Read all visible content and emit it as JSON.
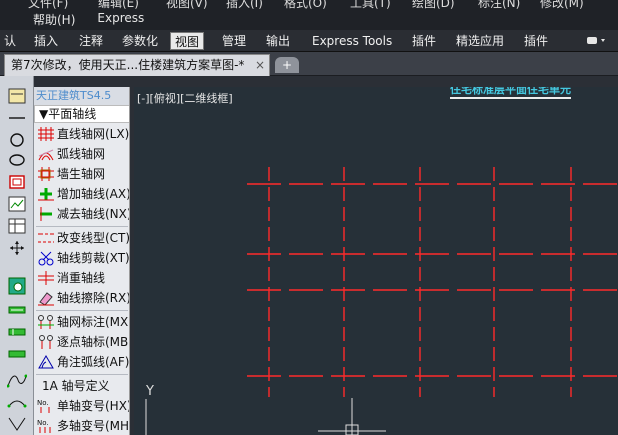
{
  "menu_cut": [
    "文件(F)",
    "编辑(E)",
    "视图(V)",
    "插入(I)",
    "格式(O)",
    "工具(T)",
    "绘图(D)",
    "标注(N)",
    "修改(M)"
  ],
  "menu": {
    "help": "帮助(H)",
    "express": "Express"
  },
  "ribbon_tabs": [
    "认",
    "插入",
    "注释",
    "参数化",
    "视图",
    "管理",
    "输出",
    "Express Tools",
    "插件",
    "精选应用",
    "插件"
  ],
  "ribbon_active": "视图",
  "ribbon_opt": "▾",
  "doc_tab": {
    "title": "第7次修改，使用天正...住楼建筑方案草图-*",
    "close": "×",
    "new": "+"
  },
  "tpanel": {
    "title": "天正建筑TS4.5",
    "group": "▼平面轴线",
    "items": [
      {
        "label": "直线轴网(LX)",
        "icon": "grid-icon"
      },
      {
        "label": "弧线轴网",
        "icon": "arc-grid-icon"
      },
      {
        "label": "墙生轴网",
        "icon": "wall-grid-icon"
      },
      {
        "label": "增加轴线(AX)",
        "icon": "add-axis-icon"
      },
      {
        "label": "减去轴线(NX)",
        "icon": "remove-axis-icon"
      },
      {
        "label": "改变线型(CT)",
        "icon": "linetype-icon"
      },
      {
        "label": "轴线剪裁(XT)",
        "icon": "scissors-icon"
      },
      {
        "label": "消重轴线",
        "icon": "dedupe-icon"
      },
      {
        "label": "轴线擦除(RX)",
        "icon": "eraser-icon"
      },
      {
        "label": "轴网标注(MX)",
        "icon": "grid-dim-icon"
      },
      {
        "label": "逐点轴标(MB)",
        "icon": "point-label-icon"
      },
      {
        "label": "角注弧线(AF)",
        "icon": "angle-arc-icon"
      },
      {
        "label": "1A 轴号定义",
        "icon": "none"
      },
      {
        "label": "单轴变号(HX)",
        "icon": "single-renum-icon"
      },
      {
        "label": "多轴变号(MH)",
        "icon": "multi-renum-icon"
      }
    ]
  },
  "canvas": {
    "viewport_label": "[-][俯视][二维线框]",
    "drawing_title": "住宅标准层平面住宅单元",
    "ucs_y": "Y"
  },
  "colors": {
    "grid_line": "#ff2a2a",
    "canvas_bg": "#263038",
    "active_tab_bg": "#e9e9e9"
  }
}
